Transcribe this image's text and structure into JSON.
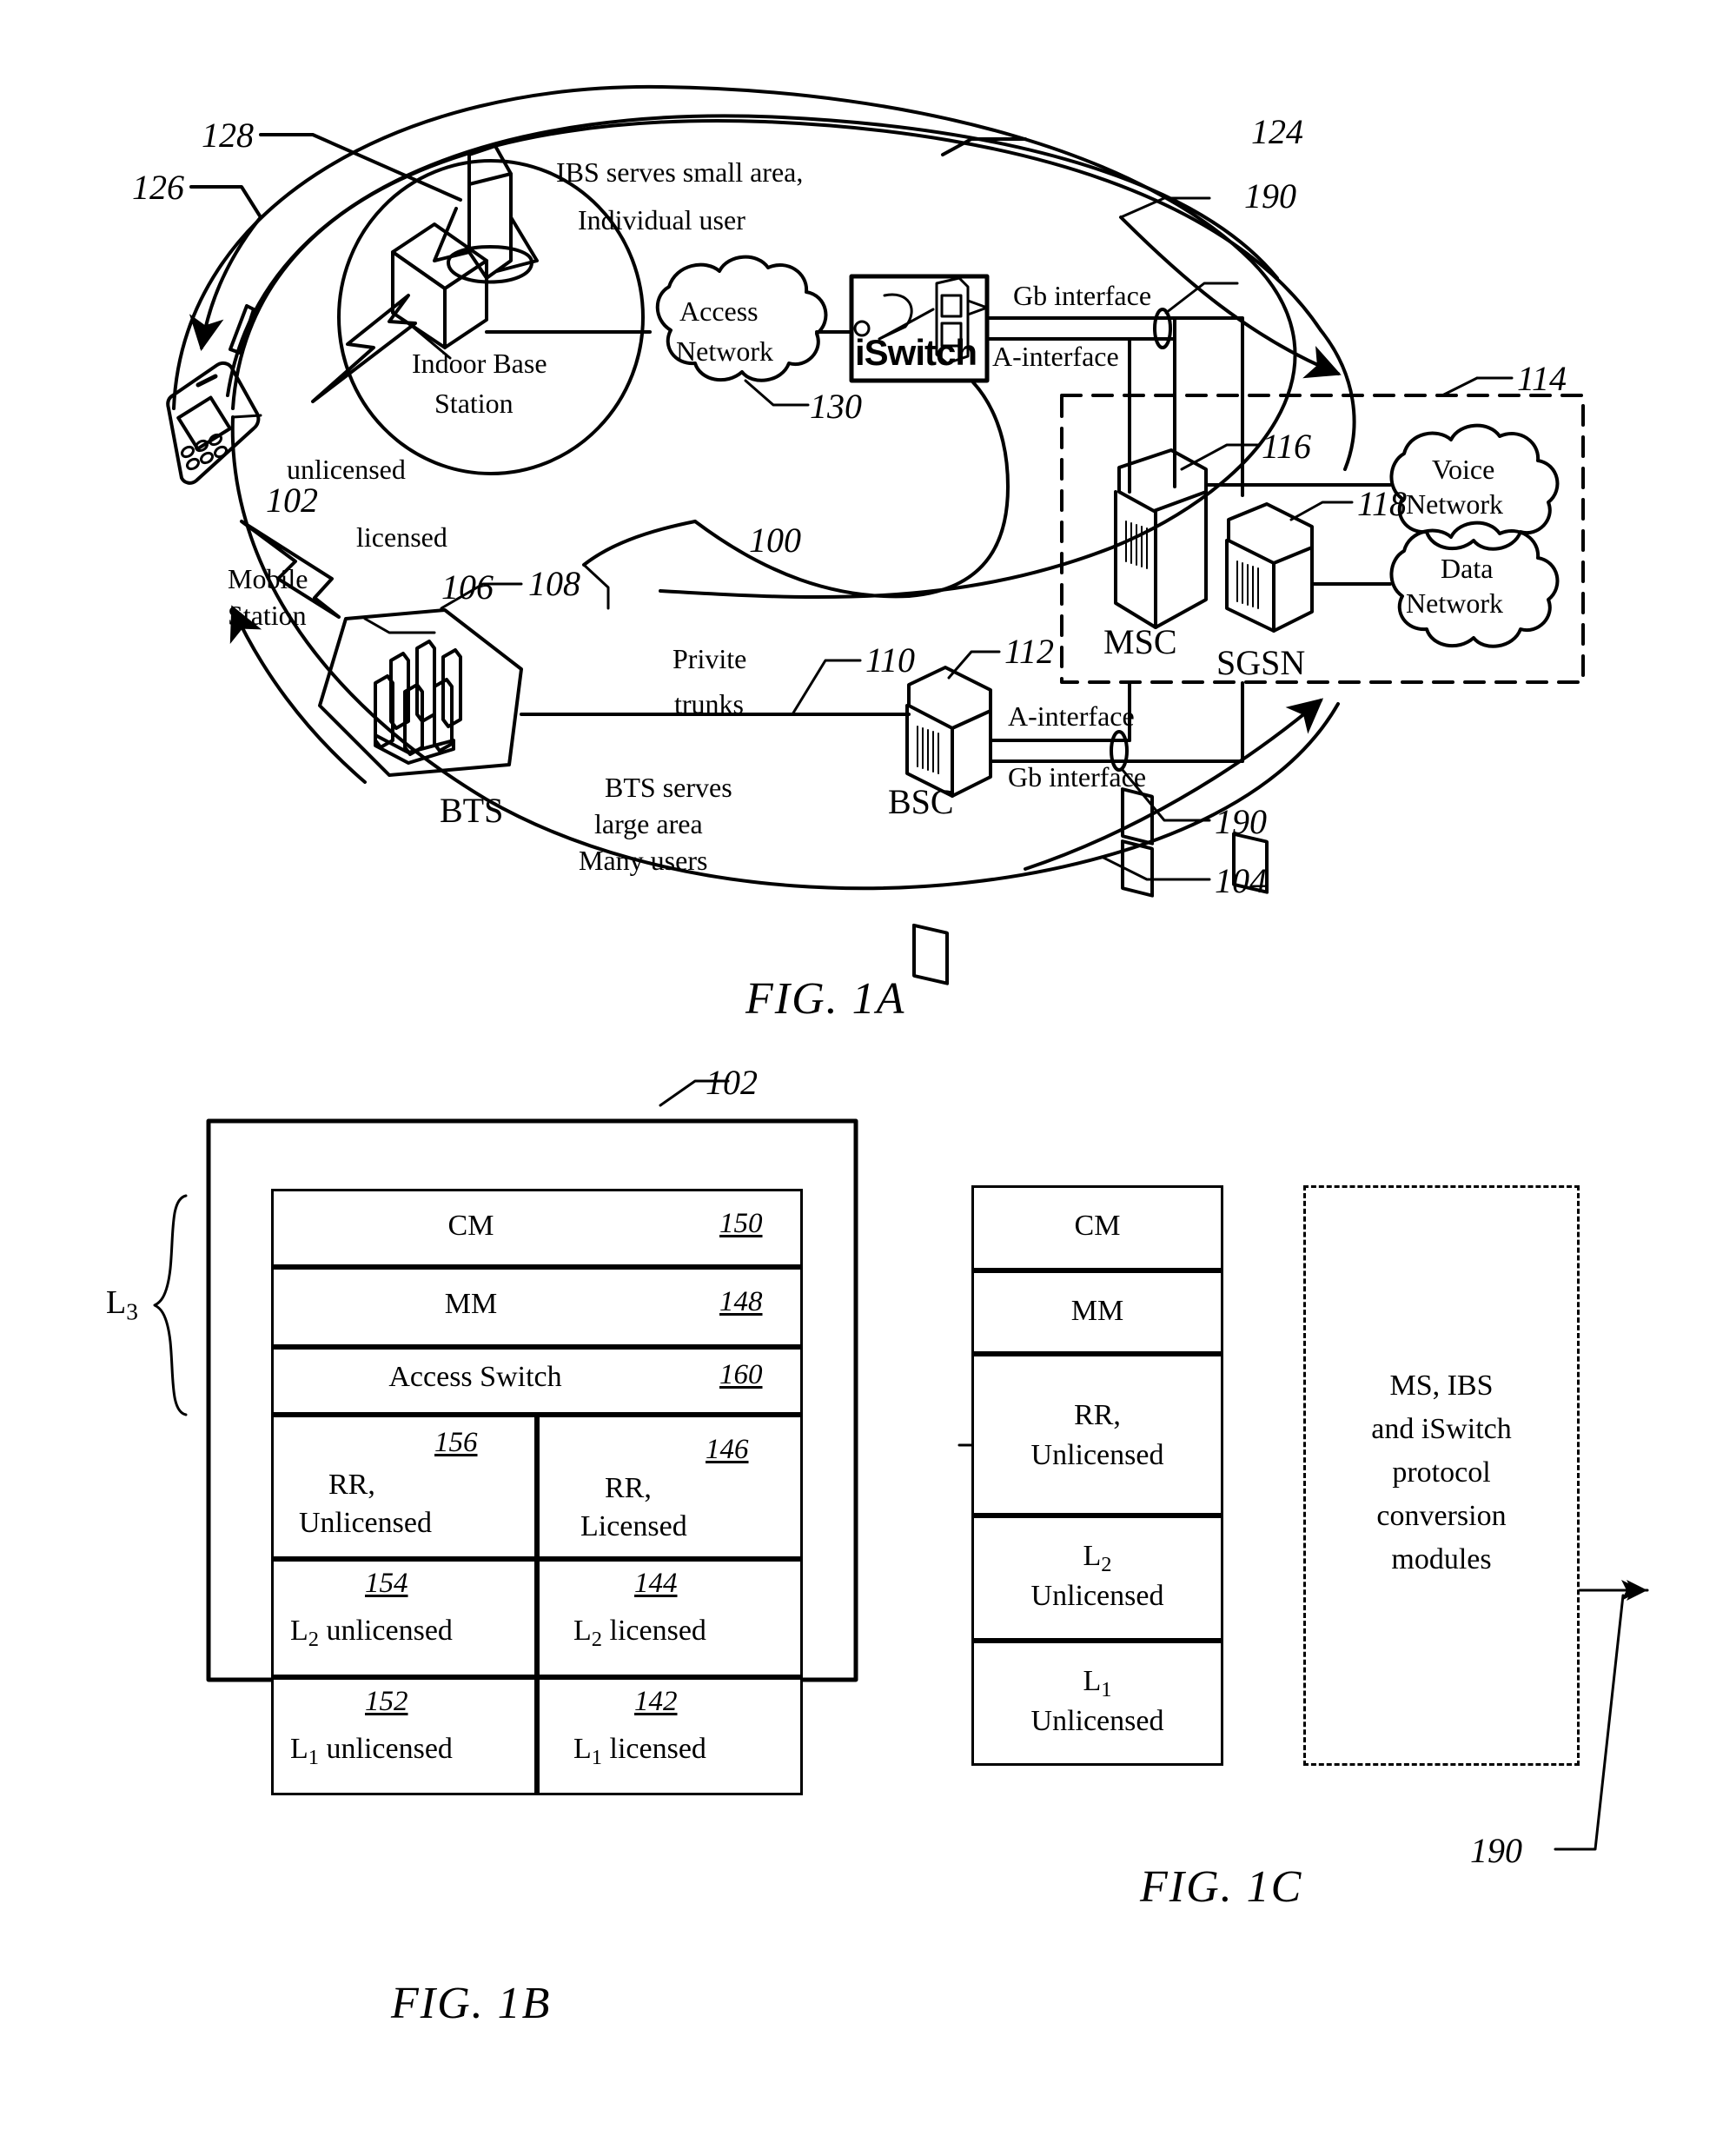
{
  "document": {
    "kind": "patent-drawing-sheet",
    "figures": [
      "FIG. 1A",
      "FIG. 1B",
      "FIG. 1C"
    ]
  },
  "fig1a": {
    "caption": "FIG. 1A",
    "annotations": {
      "ibs_note_line1": "IBS serves small area,",
      "ibs_note_line2": "Individual user",
      "bts_note_line1": "BTS serves",
      "bts_note_line2": "large area",
      "bts_note_line3": "Many users",
      "unlicensed": "unlicensed",
      "licensed": "licensed",
      "private_trunks_line1": "Privite",
      "private_trunks_line2": "trunks",
      "gb_interface_top": "Gb interface",
      "a_interface_top": "A-interface",
      "a_interface_bottom": "A-interface",
      "gb_interface_bottom": "Gb interface"
    },
    "nodes": {
      "indoor_base_station_line1": "Indoor Base",
      "indoor_base_station_line2": "Station",
      "mobile_station_line1": "Mobile",
      "mobile_station_line2": "Station",
      "access_network_line1": "Access",
      "access_network_line2": "Network",
      "iswitch": "iSwitch",
      "bts": "BTS",
      "bsc": "BSC",
      "msc": "MSC",
      "sgsn": "SGSN",
      "voice_network_line1": "Voice",
      "voice_network_line2": "Network",
      "data_network_line1": "Data",
      "data_network_line2": "Network"
    },
    "refs": {
      "r100": "100",
      "r102": "102",
      "r104": "104",
      "r106": "106",
      "r108": "108",
      "r110": "110",
      "r112": "112",
      "r114": "114",
      "r116": "116",
      "r118": "118",
      "r124": "124",
      "r126": "126",
      "r128": "128",
      "r130": "130",
      "r190_top": "190",
      "r190_bottom": "190"
    }
  },
  "fig1b": {
    "caption": "FIG. 1B",
    "outer_ref": "102",
    "bracket_label": "L",
    "bracket_sub": "3",
    "rows": [
      {
        "label": "CM",
        "ref": "150",
        "span": "full"
      },
      {
        "label": "MM",
        "ref": "148",
        "span": "full"
      },
      {
        "label": "Access Switch",
        "ref": "160",
        "span": "full"
      }
    ],
    "grid": [
      {
        "left": {
          "label_line1": "RR,",
          "label_line2": "Unlicensed",
          "ref": "156"
        },
        "right": {
          "label_line1": "RR,",
          "label_line2": "Licensed",
          "ref": "146"
        }
      },
      {
        "left": {
          "label_line1": "L",
          "label_sub": "2",
          "label_line2": " unlicensed",
          "ref": "154"
        },
        "right": {
          "label_line1": "L",
          "label_sub": "2",
          "label_line2": " licensed",
          "ref": "144"
        }
      },
      {
        "left": {
          "label_line1": "L",
          "label_sub": "1",
          "label_line2": " unlicensed",
          "ref": "152"
        },
        "right": {
          "label_line1": "L",
          "label_sub": "1",
          "label_line2": " licensed",
          "ref": "142"
        }
      }
    ]
  },
  "fig1c": {
    "caption": "FIG. 1C",
    "stack": [
      {
        "line1": "CM",
        "line2": ""
      },
      {
        "line1": "MM",
        "line2": ""
      },
      {
        "line1": "RR,",
        "line2": "Unlicensed"
      },
      {
        "line1": "L",
        "sub": "2",
        "line2": "Unlicensed"
      },
      {
        "line1": "L",
        "sub": "1",
        "line2": "Unlicensed"
      }
    ],
    "dashed_box": {
      "line1": "MS, IBS",
      "line2": "and iSwitch",
      "line3": "protocol",
      "line4": "conversion",
      "line5": "modules"
    },
    "ref_190": "190"
  },
  "colors": {
    "ink": "#000000",
    "paper": "#ffffff"
  }
}
